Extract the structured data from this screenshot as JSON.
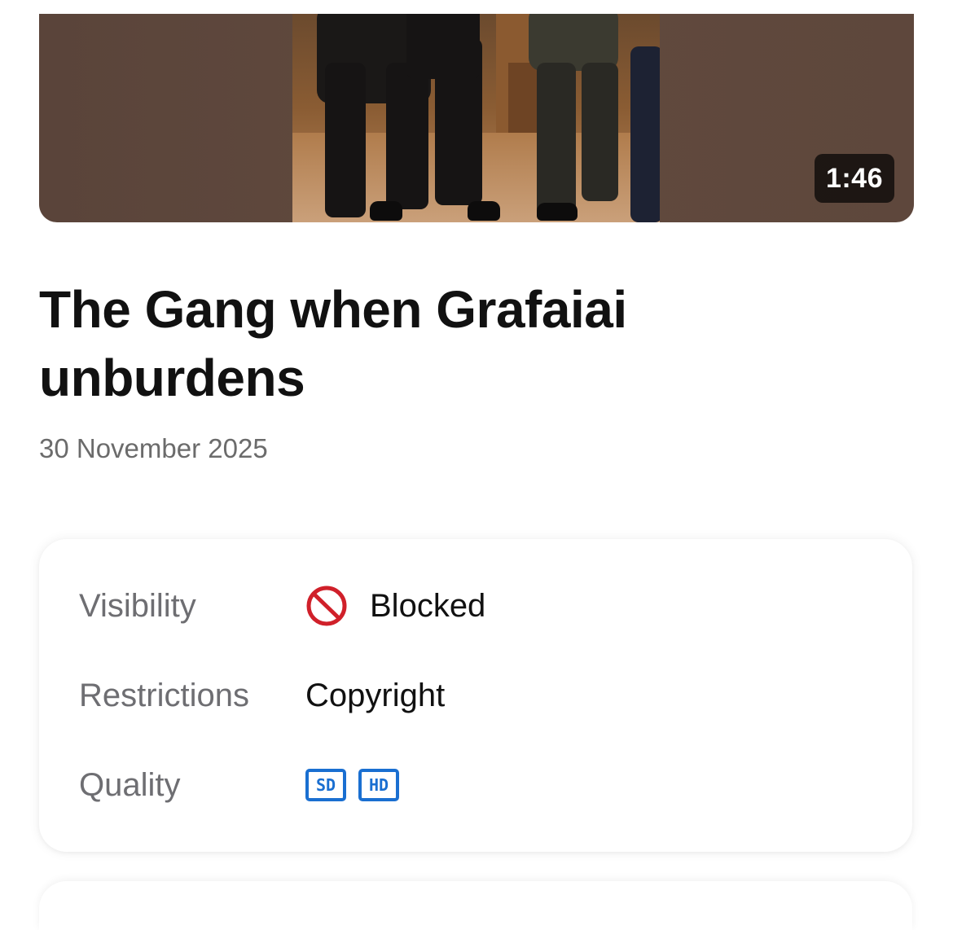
{
  "video": {
    "duration": "1:46",
    "title": "The Gang when Grafaiai unburdens",
    "date": "30 November 2025"
  },
  "details": {
    "visibility": {
      "label": "Visibility",
      "value": "Blocked",
      "icon": "blocked-icon",
      "icon_color": "#d0202a"
    },
    "restrictions": {
      "label": "Restrictions",
      "value": "Copyright"
    },
    "quality": {
      "label": "Quality",
      "badges": [
        "SD",
        "HD"
      ],
      "badge_color": "#1a6fd1"
    }
  }
}
